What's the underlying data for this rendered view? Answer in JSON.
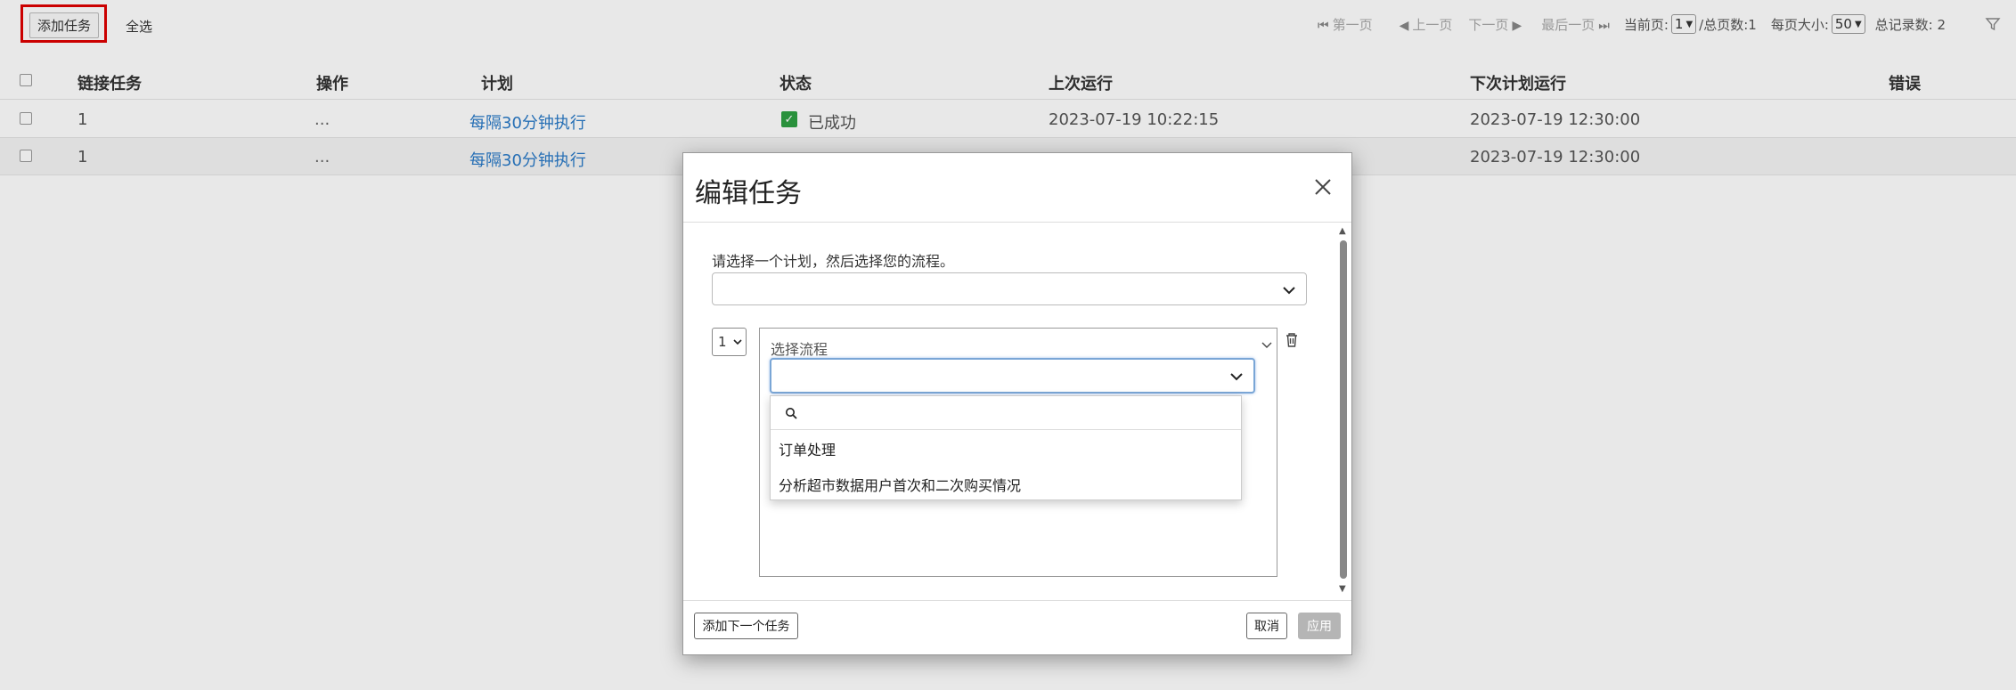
{
  "toolbar": {
    "add_task_label": "添加任务",
    "select_all_label": "全选"
  },
  "pager": {
    "first": "第一页",
    "prev": "上一页",
    "next": "下一页",
    "last": "最后一页",
    "current_page_label": "当前页:",
    "current_page": "1",
    "total_pages_label": "/总页数:1",
    "page_size_label": "每页大小:",
    "page_size": "50",
    "total_records_label": "总记录数: 2"
  },
  "table": {
    "headers": {
      "linked_task": "链接任务",
      "ops": "操作",
      "plan": "计划",
      "status": "状态",
      "last_run": "上次运行",
      "next_run": "下次计划运行",
      "error": "错误"
    },
    "rows": [
      {
        "linked_task": "1",
        "ops": "...",
        "plan": "每隔30分钟执行",
        "status": "已成功",
        "last_run": "2023-07-19 10:22:15",
        "next_run": "2023-07-19 12:30:00"
      },
      {
        "linked_task": "1",
        "ops": "...",
        "plan": "每隔30分钟执行",
        "status": "",
        "last_run": "",
        "next_run": "2023-07-19 12:30:00"
      }
    ]
  },
  "modal": {
    "title": "编辑任务",
    "prompt": "请选择一个计划，然后选择您的流程。",
    "step_number": "1",
    "flow_label": "选择流程",
    "search_value": "",
    "options": [
      "订单处理",
      "分析超市数据用户首次和二次购买情况"
    ],
    "add_next_label": "添加下一个任务",
    "cancel_label": "取消",
    "apply_label": "应用"
  },
  "colors": {
    "link": "#2a7ac7",
    "success": "#2ea043",
    "highlight": "#e00000",
    "apply_disabled": "#b5b5b5"
  }
}
